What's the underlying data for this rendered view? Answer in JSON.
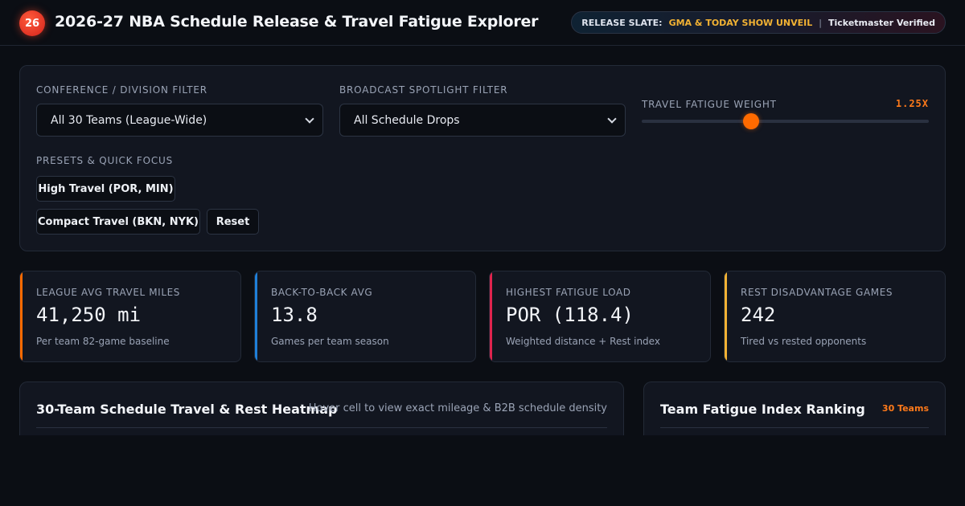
{
  "header": {
    "logo_text": "26",
    "title": "2026-27 NBA Schedule Release & Travel Fatigue Explorer",
    "release_label": "RELEASE SLATE:",
    "release_value": "GMA & TODAY SHOW UNVEIL",
    "separator": "|",
    "verified_label": "Ticketmaster Verified"
  },
  "filters": {
    "conference_label": "CONFERENCE / DIVISION FILTER",
    "conference_value": "All 30 Teams (League-Wide)",
    "broadcast_label": "BROADCAST SPOTLIGHT FILTER",
    "broadcast_value": "All Schedule Drops",
    "weight_label": "TRAVEL FATIGUE WEIGHT",
    "weight_value": "1.25X",
    "weight_fraction": 0.38,
    "presets_label": "PRESETS & QUICK FOCUS",
    "presets": {
      "high_travel": "High Travel (POR, MIN)",
      "compact_travel": "Compact Travel (BKN, NYK)",
      "reset": "Reset"
    }
  },
  "kpis": [
    {
      "label": "LEAGUE AVG TRAVEL MILES",
      "value": "41,250 mi",
      "sub": "Per team 82-game baseline",
      "color": "#ff6a00"
    },
    {
      "label": "BACK-TO-BACK AVG",
      "value": "13.8",
      "sub": "Games per team season",
      "color": "#1e7fd8"
    },
    {
      "label": "HIGHEST FATIGUE LOAD",
      "value": "POR (118.4)",
      "sub": "Weighted distance + Rest index",
      "color": "#e0244e"
    },
    {
      "label": "REST DISADVANTAGE GAMES",
      "value": "242",
      "sub": "Tired vs rested opponents",
      "color": "#f2b233"
    }
  ],
  "heatmap_panel": {
    "title": "30-Team Schedule Travel & Rest Heatmap",
    "hint": "Hover cell to view exact mileage & B2B schedule density"
  },
  "ranking_panel": {
    "title": "Team Fatigue Index Ranking",
    "badge": "30 Teams"
  }
}
